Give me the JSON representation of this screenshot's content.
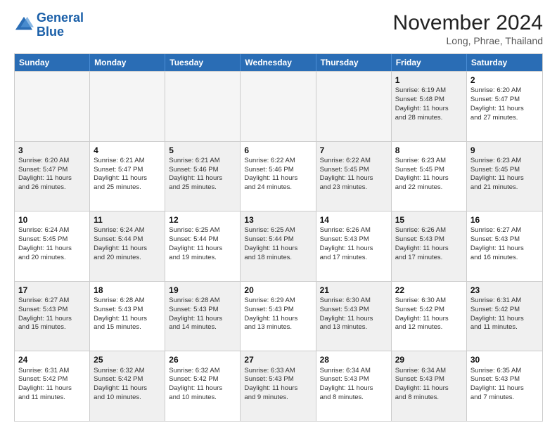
{
  "header": {
    "logo_line1": "General",
    "logo_line2": "Blue",
    "month_title": "November 2024",
    "location": "Long, Phrae, Thailand"
  },
  "days_of_week": [
    "Sunday",
    "Monday",
    "Tuesday",
    "Wednesday",
    "Thursday",
    "Friday",
    "Saturday"
  ],
  "rows": [
    [
      {
        "day": "",
        "empty": true,
        "info": ""
      },
      {
        "day": "",
        "empty": true,
        "info": ""
      },
      {
        "day": "",
        "empty": true,
        "info": ""
      },
      {
        "day": "",
        "empty": true,
        "info": ""
      },
      {
        "day": "",
        "empty": true,
        "info": ""
      },
      {
        "day": "1",
        "shaded": true,
        "info": "Sunrise: 6:19 AM\nSunset: 5:48 PM\nDaylight: 11 hours\nand 28 minutes."
      },
      {
        "day": "2",
        "shaded": false,
        "info": "Sunrise: 6:20 AM\nSunset: 5:47 PM\nDaylight: 11 hours\nand 27 minutes."
      }
    ],
    [
      {
        "day": "3",
        "shaded": true,
        "info": "Sunrise: 6:20 AM\nSunset: 5:47 PM\nDaylight: 11 hours\nand 26 minutes."
      },
      {
        "day": "4",
        "shaded": false,
        "info": "Sunrise: 6:21 AM\nSunset: 5:47 PM\nDaylight: 11 hours\nand 25 minutes."
      },
      {
        "day": "5",
        "shaded": true,
        "info": "Sunrise: 6:21 AM\nSunset: 5:46 PM\nDaylight: 11 hours\nand 25 minutes."
      },
      {
        "day": "6",
        "shaded": false,
        "info": "Sunrise: 6:22 AM\nSunset: 5:46 PM\nDaylight: 11 hours\nand 24 minutes."
      },
      {
        "day": "7",
        "shaded": true,
        "info": "Sunrise: 6:22 AM\nSunset: 5:45 PM\nDaylight: 11 hours\nand 23 minutes."
      },
      {
        "day": "8",
        "shaded": false,
        "info": "Sunrise: 6:23 AM\nSunset: 5:45 PM\nDaylight: 11 hours\nand 22 minutes."
      },
      {
        "day": "9",
        "shaded": true,
        "info": "Sunrise: 6:23 AM\nSunset: 5:45 PM\nDaylight: 11 hours\nand 21 minutes."
      }
    ],
    [
      {
        "day": "10",
        "shaded": false,
        "info": "Sunrise: 6:24 AM\nSunset: 5:45 PM\nDaylight: 11 hours\nand 20 minutes."
      },
      {
        "day": "11",
        "shaded": true,
        "info": "Sunrise: 6:24 AM\nSunset: 5:44 PM\nDaylight: 11 hours\nand 20 minutes."
      },
      {
        "day": "12",
        "shaded": false,
        "info": "Sunrise: 6:25 AM\nSunset: 5:44 PM\nDaylight: 11 hours\nand 19 minutes."
      },
      {
        "day": "13",
        "shaded": true,
        "info": "Sunrise: 6:25 AM\nSunset: 5:44 PM\nDaylight: 11 hours\nand 18 minutes."
      },
      {
        "day": "14",
        "shaded": false,
        "info": "Sunrise: 6:26 AM\nSunset: 5:43 PM\nDaylight: 11 hours\nand 17 minutes."
      },
      {
        "day": "15",
        "shaded": true,
        "info": "Sunrise: 6:26 AM\nSunset: 5:43 PM\nDaylight: 11 hours\nand 17 minutes."
      },
      {
        "day": "16",
        "shaded": false,
        "info": "Sunrise: 6:27 AM\nSunset: 5:43 PM\nDaylight: 11 hours\nand 16 minutes."
      }
    ],
    [
      {
        "day": "17",
        "shaded": true,
        "info": "Sunrise: 6:27 AM\nSunset: 5:43 PM\nDaylight: 11 hours\nand 15 minutes."
      },
      {
        "day": "18",
        "shaded": false,
        "info": "Sunrise: 6:28 AM\nSunset: 5:43 PM\nDaylight: 11 hours\nand 15 minutes."
      },
      {
        "day": "19",
        "shaded": true,
        "info": "Sunrise: 6:28 AM\nSunset: 5:43 PM\nDaylight: 11 hours\nand 14 minutes."
      },
      {
        "day": "20",
        "shaded": false,
        "info": "Sunrise: 6:29 AM\nSunset: 5:43 PM\nDaylight: 11 hours\nand 13 minutes."
      },
      {
        "day": "21",
        "shaded": true,
        "info": "Sunrise: 6:30 AM\nSunset: 5:43 PM\nDaylight: 11 hours\nand 13 minutes."
      },
      {
        "day": "22",
        "shaded": false,
        "info": "Sunrise: 6:30 AM\nSunset: 5:42 PM\nDaylight: 11 hours\nand 12 minutes."
      },
      {
        "day": "23",
        "shaded": true,
        "info": "Sunrise: 6:31 AM\nSunset: 5:42 PM\nDaylight: 11 hours\nand 11 minutes."
      }
    ],
    [
      {
        "day": "24",
        "shaded": false,
        "info": "Sunrise: 6:31 AM\nSunset: 5:42 PM\nDaylight: 11 hours\nand 11 minutes."
      },
      {
        "day": "25",
        "shaded": true,
        "info": "Sunrise: 6:32 AM\nSunset: 5:42 PM\nDaylight: 11 hours\nand 10 minutes."
      },
      {
        "day": "26",
        "shaded": false,
        "info": "Sunrise: 6:32 AM\nSunset: 5:42 PM\nDaylight: 11 hours\nand 10 minutes."
      },
      {
        "day": "27",
        "shaded": true,
        "info": "Sunrise: 6:33 AM\nSunset: 5:43 PM\nDaylight: 11 hours\nand 9 minutes."
      },
      {
        "day": "28",
        "shaded": false,
        "info": "Sunrise: 6:34 AM\nSunset: 5:43 PM\nDaylight: 11 hours\nand 8 minutes."
      },
      {
        "day": "29",
        "shaded": true,
        "info": "Sunrise: 6:34 AM\nSunset: 5:43 PM\nDaylight: 11 hours\nand 8 minutes."
      },
      {
        "day": "30",
        "shaded": false,
        "info": "Sunrise: 6:35 AM\nSunset: 5:43 PM\nDaylight: 11 hours\nand 7 minutes."
      }
    ]
  ]
}
